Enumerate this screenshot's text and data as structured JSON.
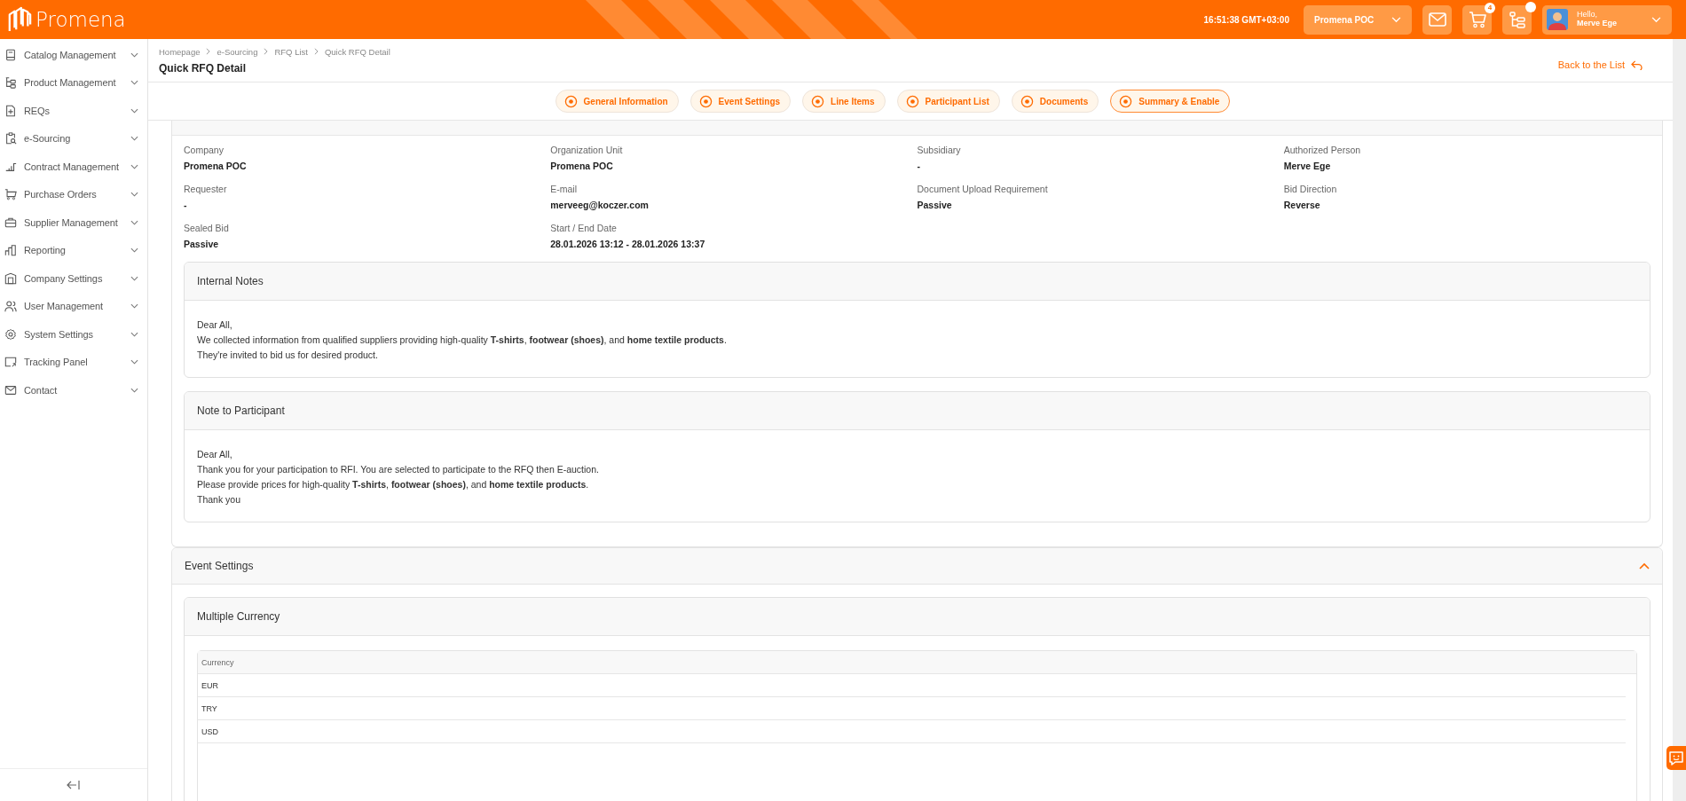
{
  "header": {
    "logo": "Promena",
    "clock": "16:51:38 GMT+03:00",
    "company": "Promena POC",
    "cart_count": "4",
    "greeting": "Hello,",
    "user": "Merve Ege"
  },
  "sidebar": {
    "items": [
      {
        "label": "Catalog Management"
      },
      {
        "label": "Product Management"
      },
      {
        "label": "REQs"
      },
      {
        "label": "e-Sourcing"
      },
      {
        "label": "Contract Management"
      },
      {
        "label": "Purchase Orders"
      },
      {
        "label": "Supplier Management"
      },
      {
        "label": "Reporting"
      },
      {
        "label": "Company Settings"
      },
      {
        "label": "User Management"
      },
      {
        "label": "System Settings"
      },
      {
        "label": "Tracking Panel"
      },
      {
        "label": "Contact"
      }
    ]
  },
  "breadcrumb": [
    "Homepage",
    "e-Sourcing",
    "RFQ List",
    "Quick RFQ Detail"
  ],
  "page_title": "Quick RFQ Detail",
  "back_link": "Back to the List",
  "steps": [
    {
      "label": "General Information",
      "selected": false
    },
    {
      "label": "Event Settings",
      "selected": false
    },
    {
      "label": "Line Items",
      "selected": false
    },
    {
      "label": "Participant List",
      "selected": false
    },
    {
      "label": "Documents",
      "selected": false
    },
    {
      "label": "Summary & Enable",
      "selected": true
    }
  ],
  "general": {
    "fields": [
      {
        "label": "Company",
        "value": "Promena POC"
      },
      {
        "label": "Organization Unit",
        "value": "Promena POC"
      },
      {
        "label": "Subsidiary",
        "value": "-"
      },
      {
        "label": "Authorized Person",
        "value": "Merve Ege"
      },
      {
        "label": "Requester",
        "value": "-"
      },
      {
        "label": "E-mail",
        "value": "merveeg@koczer.com"
      },
      {
        "label": "Document Upload Requirement",
        "value": "Passive"
      },
      {
        "label": "Bid Direction",
        "value": "Reverse"
      },
      {
        "label": "Sealed Bid",
        "value": "Passive"
      },
      {
        "label": "Start / End Date",
        "value": "28.01.2026 13:12 - 28.01.2026 13:37"
      }
    ],
    "notes": [
      {
        "title": "Internal Notes",
        "lines": [
          "Dear All,",
          "We collected information from qualified suppliers providing high-quality **T-shirts**, **footwear (shoes)**, and **home textile products**.",
          "They're invited to bid us for desired product."
        ]
      },
      {
        "title": "Note to Participant",
        "lines": [
          "Dear All,",
          "Thank you for your participation to RFI. You are selected to participate to the RFQ then E-auction.",
          "Please provide prices for high-quality **T-shirts**, **footwear (shoes)**, and **home textile products**.",
          "Thank you"
        ]
      }
    ]
  },
  "event_settings": {
    "title": "Event Settings",
    "expanded": true,
    "subsection": "Multiple Currency",
    "table": {
      "columns": [
        "Currency"
      ],
      "rows": [
        [
          "EUR"
        ],
        [
          "TRY"
        ],
        [
          "USD"
        ]
      ]
    }
  }
}
